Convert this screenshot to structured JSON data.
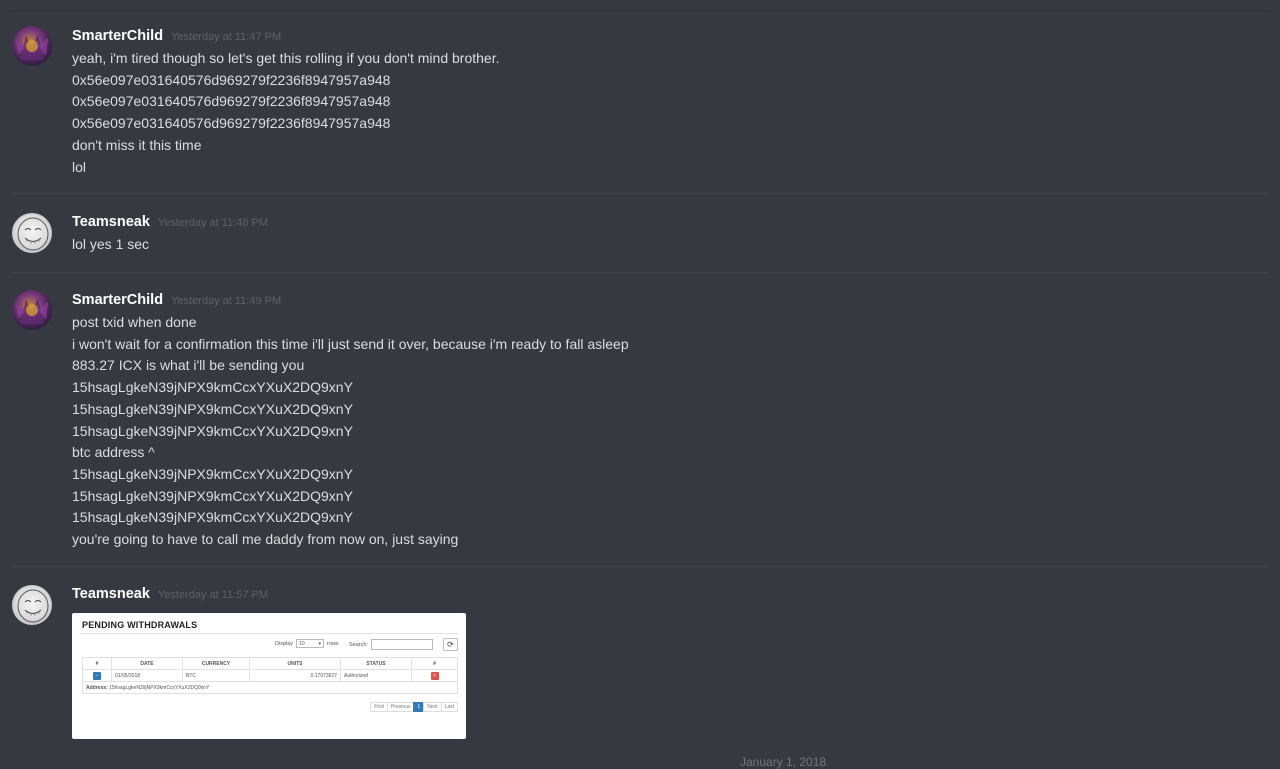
{
  "messages": [
    {
      "username": "SmarterChild",
      "timestamp": "Yesterday at 11:47 PM",
      "avatar": "purple-character-avatar",
      "lines": [
        "yeah, i'm tired though so let's get this rolling if you don't mind brother.",
        "0x56e097e031640576d969279f2236f8947957a948",
        "0x56e097e031640576d969279f2236f8947957a948",
        "0x56e097e031640576d969279f2236f8947957a948",
        "don't miss it this time",
        "lol"
      ]
    },
    {
      "username": "Teamsneak",
      "timestamp": "Yesterday at 11:48 PM",
      "avatar": "forever-alone-face-avatar",
      "lines": [
        "lol yes 1 sec"
      ]
    },
    {
      "username": "SmarterChild",
      "timestamp": "Yesterday at 11:49 PM",
      "avatar": "purple-character-avatar",
      "lines": [
        "post txid when done",
        "i won't wait for a confirmation this time i'll just send it over, because i'm ready to fall asleep",
        "883.27 ICX is what i'll be sending you",
        "15hsagLgkeN39jNPX9kmCcxYXuX2DQ9xnY",
        "15hsagLgkeN39jNPX9kmCcxYXuX2DQ9xnY",
        "15hsagLgkeN39jNPX9kmCcxYXuX2DQ9xnY",
        "btc address ^",
        "15hsagLgkeN39jNPX9kmCcxYXuX2DQ9xnY",
        "15hsagLgkeN39jNPX9kmCcxYXuX2DQ9xnY",
        "15hsagLgkeN39jNPX9kmCcxYXuX2DQ9xnY",
        "you're going to have to call me daddy from now on, just saying"
      ]
    },
    {
      "username": "Teamsneak",
      "timestamp": "Yesterday at 11:57 PM",
      "avatar": "forever-alone-face-avatar",
      "lines": []
    }
  ],
  "attachment": {
    "title": "PENDING WITHDRAWALS",
    "display_label": "Display",
    "display_value": "10",
    "rows_label": "rows",
    "search_label": "Search:",
    "columns": [
      "#",
      "DATE",
      "CURRENCY",
      "UNITS",
      "STATUS",
      "#"
    ],
    "row": {
      "date": "01/05/2018",
      "currency": "BTC",
      "units": "0.17973627",
      "status": "Authorized"
    },
    "address_label": "Address:",
    "address_value": "15hsagLgkeN39jNPX9kmCcxYXuX2DQ9xnY",
    "pager": [
      "First",
      "Previous",
      "1",
      "Next",
      "Last"
    ]
  },
  "date_separator": "January 1, 2018",
  "colors": {
    "background": "#36393f",
    "username": "#ffffff",
    "text": "#dcddde",
    "timestamp": "#5d6066"
  }
}
